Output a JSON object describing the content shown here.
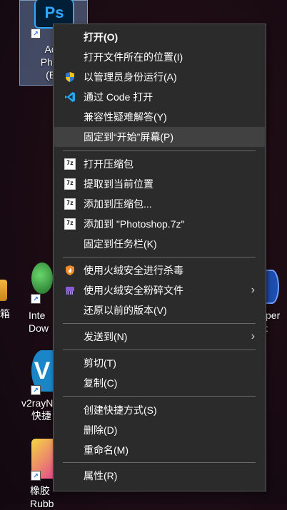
{
  "desktop": {
    "icons": [
      {
        "id": "photoshop",
        "lines": [
          "Ado",
          "Photo",
          "(Be"
        ],
        "tile": "Ps"
      },
      {
        "id": "toolbox",
        "lines": [
          "箱"
        ]
      },
      {
        "id": "internet-download",
        "lines": [
          "Inte",
          "Dow"
        ]
      },
      {
        "id": "v2ray",
        "lines": [
          "v2rayN",
          "快捷"
        ]
      },
      {
        "id": "rubber",
        "lines": [
          "橡胶",
          "Rubb"
        ]
      },
      {
        "id": "right-app",
        "lines": [
          "per",
          ":"
        ]
      }
    ]
  },
  "menu": {
    "items": [
      {
        "label": "打开(O)",
        "bold": true,
        "icon": ""
      },
      {
        "label": "打开文件所在的位置(I)",
        "icon": ""
      },
      {
        "label": "以管理员身份运行(A)",
        "icon": "uac-shield-icon"
      },
      {
        "label": "通过 Code 打开",
        "icon": "vscode-icon"
      },
      {
        "label": "兼容性疑难解答(Y)",
        "icon": ""
      },
      {
        "label": "固定到“开始”屏幕(P)",
        "icon": "",
        "highlighted": true
      },
      {
        "label": "打开压缩包",
        "icon": "7zip-icon"
      },
      {
        "label": "提取到当前位置",
        "icon": "7zip-icon"
      },
      {
        "label": "添加到压缩包...",
        "icon": "7zip-icon"
      },
      {
        "label": "添加到 \"Photoshop.7z\"",
        "icon": "7zip-icon"
      },
      {
        "label": "固定到任务栏(K)",
        "icon": ""
      },
      {
        "label": "使用火绒安全进行杀毒",
        "icon": "huorong-shield-icon"
      },
      {
        "label": "使用火绒安全粉碎文件",
        "icon": "huorong-shredder-icon",
        "submenu": true
      },
      {
        "label": "还原以前的版本(V)",
        "icon": ""
      },
      {
        "label": "发送到(N)",
        "icon": "",
        "submenu": true
      },
      {
        "label": "剪切(T)",
        "icon": ""
      },
      {
        "label": "复制(C)",
        "icon": ""
      },
      {
        "label": "创建快捷方式(S)",
        "icon": ""
      },
      {
        "label": "删除(D)",
        "icon": ""
      },
      {
        "label": "重命名(M)",
        "icon": ""
      },
      {
        "label": "属性(R)",
        "icon": ""
      }
    ],
    "zip_badge": "7z",
    "arrow_glyph": "›"
  },
  "colors": {
    "menu_bg": "#2b2b2b",
    "highlight": "#414141",
    "ps_blue": "#31a8ff",
    "vscode_blue": "#23a9f2",
    "huorong_orange": "#f08a24",
    "shredder_purple": "#8a5ad6"
  }
}
